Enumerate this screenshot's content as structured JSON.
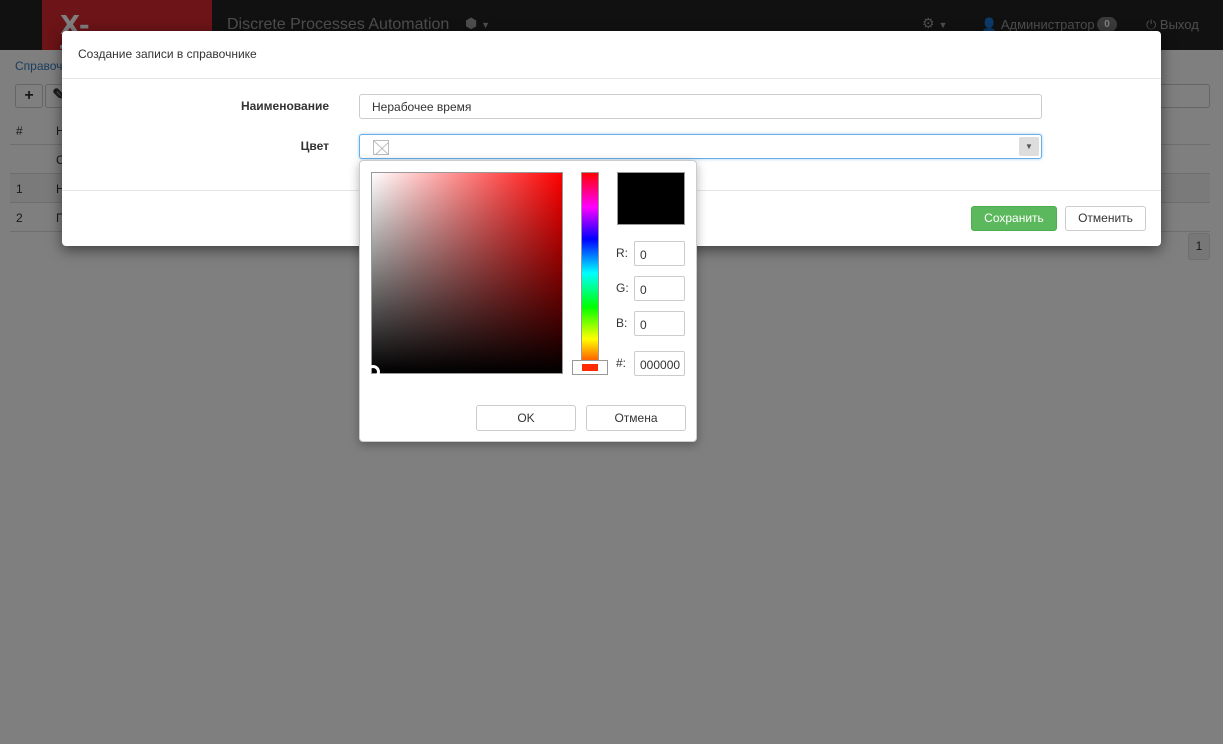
{
  "navbar": {
    "brand": "X-TENSIVE",
    "app_title": "Discrete Processes Automation",
    "user": "Администратор",
    "notifications_count": "0",
    "logout": "Выход"
  },
  "background": {
    "breadcrumb": "Справоч",
    "table": {
      "header": [
        "#",
        "Н"
      ],
      "filter_row": [
        "",
        "С"
      ],
      "rows": [
        {
          "num": "1",
          "name": "Н"
        },
        {
          "num": "2",
          "name": "П"
        }
      ]
    },
    "page": "1"
  },
  "modal": {
    "title": "Создание записи в справочнике",
    "name_label": "Наименование",
    "name_value": "Нерабочее время",
    "color_label": "Цвет",
    "save_label": "Сохранить",
    "cancel_label": "Отменить"
  },
  "color_picker": {
    "hue_color": "#ff0000",
    "selected_color": "#000000",
    "r_label": "R:",
    "g_label": "G:",
    "b_label": "B:",
    "hex_label": "#:",
    "r": "0",
    "g": "0",
    "b": "0",
    "hex": "000000",
    "ok_label": "OK",
    "cancel_label": "Отмена"
  }
}
